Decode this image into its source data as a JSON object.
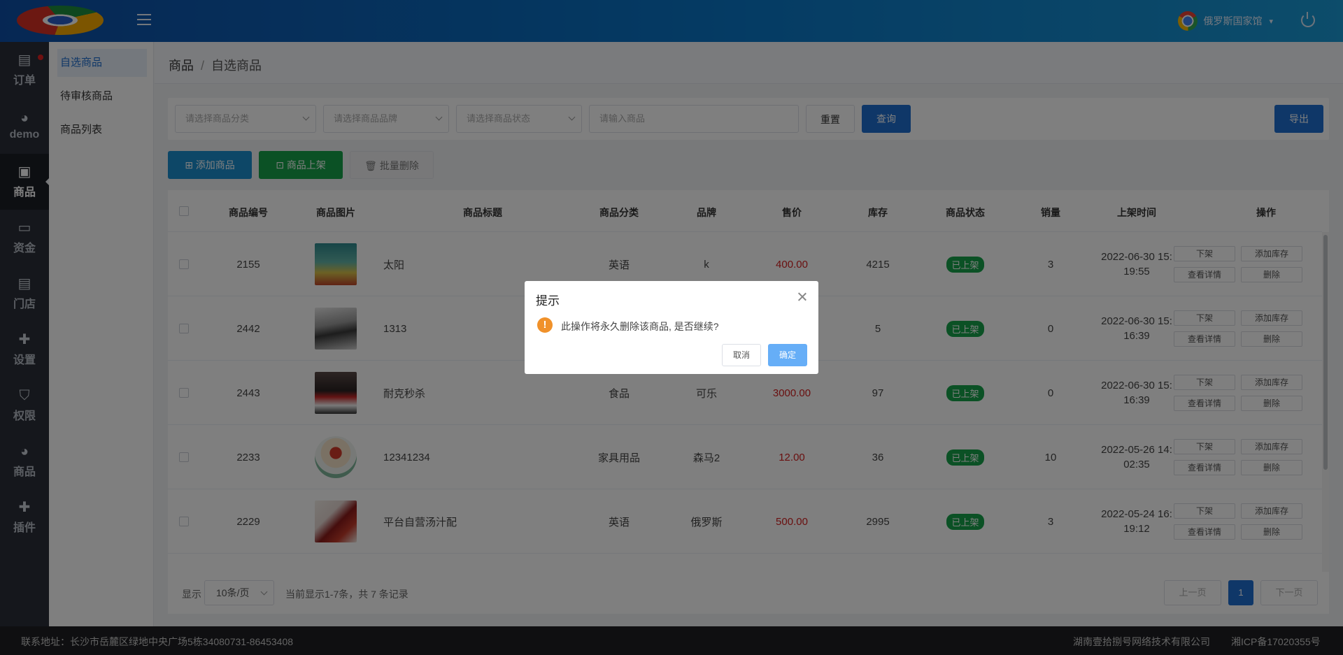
{
  "header": {
    "user_name": "俄罗斯国家馆"
  },
  "leftnav": [
    {
      "label": "订单",
      "icon": "clipboard-icon"
    },
    {
      "label": "demo",
      "icon": "pie-chart-icon"
    },
    {
      "label": "商品",
      "icon": "bag-icon"
    },
    {
      "label": "资金",
      "icon": "wallet-icon"
    },
    {
      "label": "门店",
      "icon": "store-icon"
    },
    {
      "label": "设置",
      "icon": "puzzle-icon"
    },
    {
      "label": "权限",
      "icon": "shield-icon"
    },
    {
      "label": "商品",
      "icon": "pie-chart-icon"
    },
    {
      "label": "插件",
      "icon": "puzzle-icon"
    }
  ],
  "subnav": [
    "自选商品",
    "待审核商品",
    "商品列表"
  ],
  "breadcrumb": {
    "root": "商品",
    "sep": "/",
    "current": "自选商品"
  },
  "filters": {
    "category_placeholder": "请选择商品分类",
    "brand_placeholder": "请选择商品品牌",
    "status_placeholder": "请选择商品状态",
    "keyword_placeholder": "请输入商品",
    "reset": "重置",
    "search": "查询",
    "export": "导出"
  },
  "actions": {
    "add": "添加商品",
    "list_on": "商品上架",
    "batch_delete": "批量删除"
  },
  "table": {
    "headers": [
      "商品编号",
      "商品图片",
      "商品标题",
      "商品分类",
      "品牌",
      "售价",
      "库存",
      "商品状态",
      "销量",
      "上架时间",
      "操作"
    ],
    "row_buttons": {
      "off": "下架",
      "add_stock": "添加库存",
      "view": "查看详情",
      "delete": "删除"
    },
    "rows": [
      {
        "id": "2155",
        "title": "太阳",
        "category": "英语",
        "brand": "k",
        "price": "400.00",
        "stock": "4215",
        "status": "已上架",
        "sales": "3",
        "time_1": "2022-06-30 15:",
        "time_2": "19:55"
      },
      {
        "id": "2442",
        "title": "1313",
        "category": "",
        "brand": "",
        "price": "",
        "stock": "5",
        "status": "已上架",
        "sales": "0",
        "time_1": "2022-06-30 15:",
        "time_2": "16:39"
      },
      {
        "id": "2443",
        "title": "耐克秒杀",
        "category": "食品",
        "brand": "可乐",
        "price": "3000.00",
        "stock": "97",
        "status": "已上架",
        "sales": "0",
        "time_1": "2022-06-30 15:",
        "time_2": "16:39"
      },
      {
        "id": "2233",
        "title": "12341234",
        "category": "家具用品",
        "brand": "森马2",
        "price": "12.00",
        "stock": "36",
        "status": "已上架",
        "sales": "10",
        "time_1": "2022-05-26 14:",
        "time_2": "02:35"
      },
      {
        "id": "2229",
        "title": "平台自营汤汁配",
        "category": "英语",
        "brand": "俄罗斯",
        "price": "500.00",
        "stock": "2995",
        "status": "已上架",
        "sales": "3",
        "time_1": "2022-05-24 16:",
        "time_2": "19:12"
      }
    ]
  },
  "pager": {
    "show_label": "显示",
    "page_size": "10条/页",
    "summary": "当前显示1-7条，共 7 条记录",
    "prev": "上一页",
    "current": "1",
    "next": "下一页"
  },
  "footer": {
    "address": "联系地址：长沙市岳麓区绿地中央广场5栋34080731-86453408",
    "company": "湖南壹拾捌号网络技术有限公司",
    "icp": "湘ICP备17020355号"
  },
  "dialog": {
    "title": "提示",
    "message": "此操作将永久删除该商品, 是否继续?",
    "cancel": "取消",
    "confirm": "确定"
  },
  "colors": {
    "primary": "#1e6fd0",
    "success": "#17a34a",
    "price": "#d42020",
    "warning": "#f0912a"
  }
}
